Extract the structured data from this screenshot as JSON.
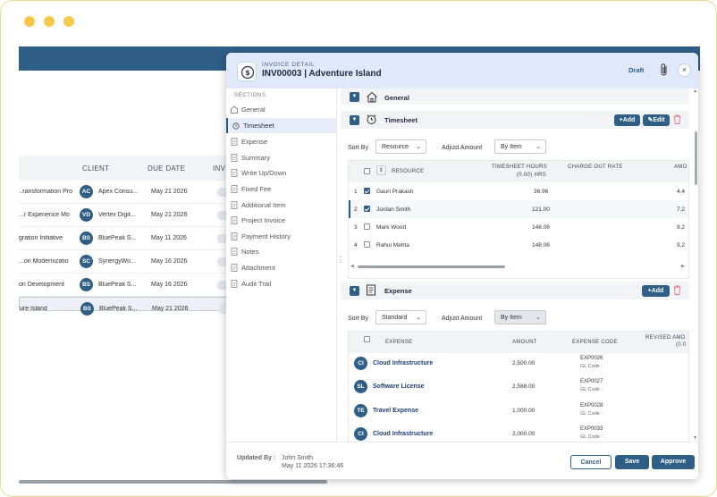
{
  "background": {
    "columns": [
      "CLIENT",
      "DUE DATE",
      "INV"
    ],
    "rows": [
      {
        "project": "ransformation Pro...",
        "initials": "AC",
        "client": "Apex Consu...",
        "due": "May 21 2026"
      },
      {
        "project": "r Experience Mo...",
        "initials": "VD",
        "client": "Vertex Digit...",
        "due": "May 21 2026"
      },
      {
        "project": "gration Initiative",
        "initials": "BS",
        "client": "BluePeak S...",
        "due": "May 11 2026"
      },
      {
        "project": "on Modernizatio...",
        "initials": "SC",
        "client": "SynergyWo...",
        "due": "May 16 2026"
      },
      {
        "project": "on Development",
        "initials": "BS",
        "client": "BluePeak S...",
        "due": "May 16 2026"
      },
      {
        "project": "ure Island",
        "initials": "BS",
        "client": "BluePeak S...",
        "due": "May 21 2026"
      }
    ]
  },
  "modal": {
    "subtitle": "INVOICE DETAIL",
    "title": "INV00003 | Adventure Island",
    "status": "Draft",
    "close": "×",
    "sections_caption": "SECTIONS",
    "sections": [
      "General",
      "Timesheet",
      "Expense",
      "Summary",
      "Write Up/Down",
      "Fixed Fee",
      "Additional Item",
      "Project Invoice",
      "Payment History",
      "Notes",
      "Attachment",
      "Audit Trail"
    ],
    "general": {
      "title": "General"
    },
    "timesheet": {
      "title": "Timesheet",
      "add": "+Add",
      "edit": "Edit",
      "sort_label": "Sort By",
      "sort_value": "Resource",
      "adjust_label": "Adjust Amount",
      "adjust_value": "By Item",
      "headers": {
        "resource": "RESOURCE",
        "hours": "TIMESHEET HOURS",
        "hours_sub": "(0.00) HRS",
        "rate": "CHARGE OUT RATE",
        "amount": "AMO"
      },
      "rows": [
        {
          "no": "1",
          "checked": true,
          "name": "Gauri Prakash",
          "hours": "36.96",
          "amount": "4,4"
        },
        {
          "no": "2",
          "checked": true,
          "name": "Jordan Smith",
          "hours": "121.00",
          "amount": "7,2"
        },
        {
          "no": "3",
          "checked": false,
          "name": "Mark Wood",
          "hours": "148.06",
          "amount": "9,2"
        },
        {
          "no": "4",
          "checked": false,
          "name": "Rahul Mehta",
          "hours": "148.06",
          "amount": "9,2"
        }
      ]
    },
    "expense": {
      "title": "Expense",
      "add": "+Add",
      "sort_label": "Sort By",
      "sort_value": "Standard",
      "adjust_label": "Adjust Amount",
      "adjust_value": "By Item",
      "headers": {
        "expense": "EXPENSE",
        "amount": "AMOUNT",
        "code": "EXPENSE  CODE",
        "revised": "REVISED AMO",
        "revised_sub": "(0.0"
      },
      "rows": [
        {
          "initials": "CI",
          "name": "Cloud Infrastructure",
          "amount": "2,500.00",
          "code": "EXP0026",
          "gl": "GL Code :"
        },
        {
          "initials": "SL",
          "name": "Software License",
          "amount": "2,568.00",
          "code": "EXP0027",
          "gl": "GL Code :"
        },
        {
          "initials": "TE",
          "name": "Travel Expense",
          "amount": "1,000.00",
          "code": "EXP0028",
          "gl": "GL Code :"
        },
        {
          "initials": "CI",
          "name": "Cloud Infrastructure",
          "amount": "2,000.00",
          "code": "EXP0033",
          "gl": "GL Code :"
        }
      ]
    },
    "footer": {
      "updated_label": "Updated By  :",
      "updated_name": "John Smith",
      "updated_time": "May 11 2026 17:36:46",
      "cancel": "Cancel",
      "save": "Save",
      "approve": "Approve"
    }
  }
}
